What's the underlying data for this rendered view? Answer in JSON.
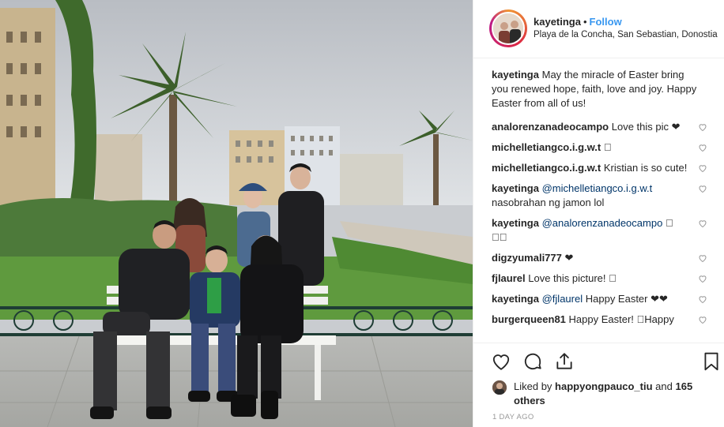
{
  "post": {
    "username": "kayetinga",
    "separator": "•",
    "follow_label": "Follow",
    "location": "Playa de la Concha, San Sebastian, Donostia"
  },
  "caption": {
    "username": "kayetinga",
    "text": "May the miracle of Easter bring you renewed hope, faith, love and joy. Happy Easter from all of us!"
  },
  "comments": [
    {
      "username": "analorenzanadeocampo",
      "text": "Love this pic ❤"
    },
    {
      "username": "michelletiangco.i.g.w.t",
      "text": "􏿾"
    },
    {
      "username": "michelletiangco.i.g.w.t",
      "text": "Kristian is so cute!"
    },
    {
      "username": "kayetinga",
      "mention": "@michelletiangco.i.g.w.t",
      "text": "nasobrahan ng jamon lol"
    },
    {
      "username": "kayetinga",
      "mention": "@analorenzanadeocampo",
      "text": "􏿾 􏿾􏿾"
    },
    {
      "username": "digzyumali777",
      "text": "❤"
    },
    {
      "username": "fjlaurel",
      "text": "Love this picture! 􏿾"
    },
    {
      "username": "kayetinga",
      "mention": "@fjlaurel",
      "text": "Happy Easter ❤❤"
    },
    {
      "username": "burgerqueen81",
      "text": "Happy Easter! 􏿾Happy"
    }
  ],
  "actions": {
    "like_icon": "heart-outline-icon",
    "comment_icon": "comment-bubble-icon",
    "share_icon": "share-upload-icon",
    "save_icon": "bookmark-icon"
  },
  "likes": {
    "prefix": "Liked by",
    "user": "happyongpauco_tiu",
    "and": "and",
    "others": "165 others"
  },
  "timestamp": "1 DAY AGO",
  "colors": {
    "link_blue": "#3897f0",
    "mention_blue": "#003569",
    "text": "#262626",
    "muted": "#999999",
    "border": "#efefef"
  }
}
